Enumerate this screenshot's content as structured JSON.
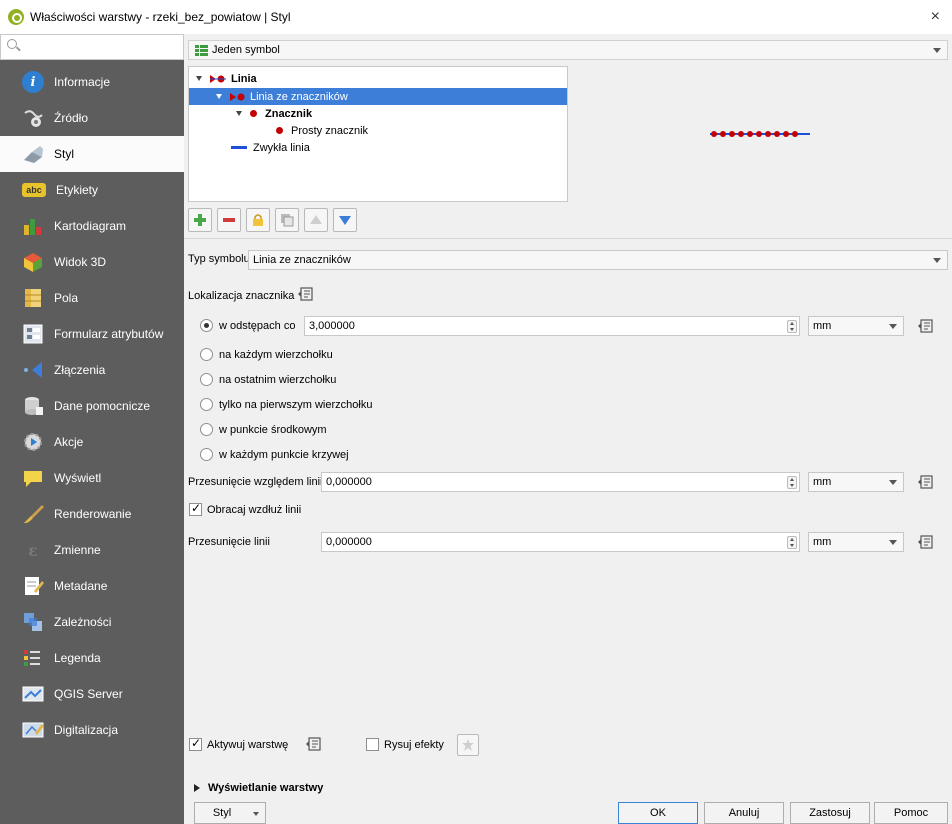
{
  "window": {
    "title": "Właściwości warstwy - rzeki_bez_powiatow | Styl",
    "close_label": "×"
  },
  "sidebar": {
    "search_placeholder": "",
    "items": [
      {
        "label": "Informacje",
        "icon": "info-icon",
        "active": false
      },
      {
        "label": "Źródło",
        "icon": "source-icon",
        "active": false
      },
      {
        "label": "Styl",
        "icon": "style-brush-icon",
        "active": true
      },
      {
        "label": "Etykiety",
        "icon": "labels-abc-icon",
        "active": false
      },
      {
        "label": "Kartodiagram",
        "icon": "diagram-icon",
        "active": false
      },
      {
        "label": "Widok 3D",
        "icon": "cube-3d-icon",
        "active": false
      },
      {
        "label": "Pola",
        "icon": "fields-icon",
        "active": false
      },
      {
        "label": "Formularz atrybutów",
        "icon": "form-icon",
        "active": false
      },
      {
        "label": "Złączenia",
        "icon": "joins-icon",
        "active": false
      },
      {
        "label": "Dane pomocnicze",
        "icon": "auxiliary-storage-icon",
        "active": false
      },
      {
        "label": "Akcje",
        "icon": "actions-icon",
        "active": false
      },
      {
        "label": "Wyświetl",
        "icon": "display-tip-icon",
        "active": false
      },
      {
        "label": "Renderowanie",
        "icon": "rendering-icon",
        "active": false
      },
      {
        "label": "Zmienne",
        "icon": "variables-icon",
        "active": false
      },
      {
        "label": "Metadane",
        "icon": "metadata-icon",
        "active": false
      },
      {
        "label": "Zależności",
        "icon": "dependencies-icon",
        "active": false
      },
      {
        "label": "Legenda",
        "icon": "legend-icon",
        "active": false
      },
      {
        "label": "QGIS Server",
        "icon": "server-icon",
        "active": false
      },
      {
        "label": "Digitalizacja",
        "icon": "digitizing-icon",
        "active": false
      }
    ]
  },
  "renderer": {
    "selected": "Jeden symbol"
  },
  "symbol_tree": {
    "root": "Linia",
    "layer": "Linia ze znaczników",
    "marker": "Znacznik",
    "simple_marker": "Prosty znacznik",
    "simple_line": "Zwykła linia"
  },
  "symbol_type": {
    "label": "Typ symbolu",
    "value": "Linia ze znaczników"
  },
  "placement": {
    "label": "Lokalizacja znacznika",
    "options": [
      {
        "label": "w odstępach co",
        "checked": true
      },
      {
        "label": "na każdym wierzchołku",
        "checked": false
      },
      {
        "label": "na ostatnim wierzchołku",
        "checked": false
      },
      {
        "label": "tylko na pierwszym wierzchołku",
        "checked": false
      },
      {
        "label": "w punkcie środkowym",
        "checked": false
      },
      {
        "label": "w każdym punkcie krzywej",
        "checked": false
      }
    ],
    "interval_value": "3,000000",
    "interval_unit": "mm"
  },
  "offset_along": {
    "label": "Przesunięcie względem linii",
    "value": "0,000000",
    "unit": "mm"
  },
  "rotate": {
    "label": "Obracaj wzdłuż linii",
    "checked": true
  },
  "line_offset": {
    "label": "Przesunięcie linii",
    "value": "0,000000",
    "unit": "mm"
  },
  "bottom": {
    "enable_layer": "Aktywuj warstwę",
    "draw_effects": "Rysuj efekty",
    "layer_rendering": "Wyświetlanie warstwy"
  },
  "buttons": {
    "style": "Styl",
    "ok": "OK",
    "cancel": "Anuluj",
    "apply": "Zastosuj",
    "help": "Pomoc"
  },
  "colors": {
    "selection": "#3d7ed8",
    "sidebar": "#5d5d5d",
    "marker_red": "#c40000",
    "line_blue": "#1f4fd8"
  }
}
